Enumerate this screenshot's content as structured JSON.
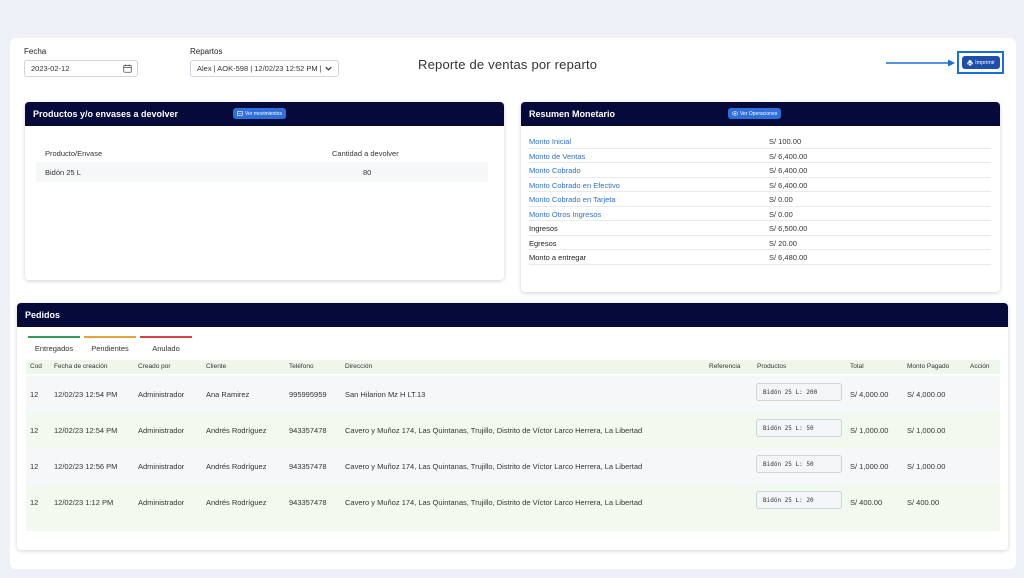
{
  "filters": {
    "fecha_label": "Fecha",
    "fecha_value": "2023-02-12",
    "repartos_label": "Repartos",
    "repartos_value": "Alex | AOK-598 | 12/02/23 12:52 PM |"
  },
  "page_title": "Reporte de ventas por reparto",
  "print_label": "Imprimir",
  "colors": {
    "navy": "#050a3a",
    "accent": "#1f4fa8",
    "link": "#2f6fc4",
    "tab_green": "#3a9a5a",
    "tab_orange": "#e8a23a",
    "tab_red": "#d64545"
  },
  "productos": {
    "title": "Productos y/o envases a devolver",
    "button": "Ver movimientos",
    "headers": [
      "Producto/Envase",
      "Cantidad a devolver"
    ],
    "rows": [
      {
        "producto": "Bidón 25 L",
        "cantidad": "80"
      }
    ]
  },
  "resumen": {
    "title": "Resumen Monetario",
    "button": "Ver Operaciones",
    "rows": [
      {
        "label": "Monto Inicial",
        "value": "S/ 100.00",
        "link": true
      },
      {
        "label": "Monto de Ventas",
        "value": "S/ 6,400.00",
        "link": true
      },
      {
        "label": "Monto Cobrado",
        "value": "S/ 6,400.00",
        "link": true
      },
      {
        "label": "Monto Cobrado en Efectivo",
        "value": "S/ 6,400.00",
        "link": true
      },
      {
        "label": "Monto Cobrado en Tarjeta",
        "value": "S/ 0.00",
        "link": true
      },
      {
        "label": "Monto Otros Ingresos",
        "value": "S/ 0.00",
        "link": true
      },
      {
        "label": "Ingresos",
        "value": "S/ 6,500.00",
        "link": false
      },
      {
        "label": "Egresos",
        "value": "S/ 20.00",
        "link": false
      },
      {
        "label": "Monto a entregar",
        "value": "S/ 6,480.00",
        "link": false
      }
    ]
  },
  "pedidos": {
    "title": "Pedidos",
    "tabs": [
      "Entregados",
      "Pendientes",
      "Anulado"
    ],
    "headers": [
      "Cod",
      "Fecha de creación",
      "Creado por",
      "Cliente",
      "Teléfono",
      "Dirección",
      "Referencia",
      "Productos",
      "Total",
      "Monto Pagado",
      "Acción"
    ],
    "rows": [
      {
        "cod": "12",
        "fecha": "12/02/23 12:54 PM",
        "creado": "Administrador",
        "cliente": "Ana Ramirez",
        "telefono": "995995959",
        "direccion": "San Hilarion Mz H LT.13",
        "referencia": "",
        "productos": "Bidón 25 L: 200",
        "total": "S/ 4,000.00",
        "pagado": "S/ 4,000.00"
      },
      {
        "cod": "12",
        "fecha": "12/02/23 12:54 PM",
        "creado": "Administrador",
        "cliente": "Andrés Rodríguez",
        "telefono": "943357478",
        "direccion": "Cavero y Muñoz 174, Las Quintanas, Trujillo, Distrito de Víctor Larco Herrera, La Libertad",
        "referencia": "",
        "productos": "Bidón 25 L: 50",
        "total": "S/ 1,000.00",
        "pagado": "S/ 1,000.00"
      },
      {
        "cod": "12",
        "fecha": "12/02/23 12:56 PM",
        "creado": "Administrador",
        "cliente": "Andrés Rodríguez",
        "telefono": "943357478",
        "direccion": "Cavero y Muñoz 174, Las Quintanas, Trujillo, Distrito de Víctor Larco Herrera, La Libertad",
        "referencia": "",
        "productos": "Bidón 25 L: 50",
        "total": "S/ 1,000.00",
        "pagado": "S/ 1,000.00"
      },
      {
        "cod": "12",
        "fecha": "12/02/23 1:12 PM",
        "creado": "Administrador",
        "cliente": "Andrés Rodríguez",
        "telefono": "943357478",
        "direccion": "Cavero y Muñoz 174, Las Quintanas, Trujillo, Distrito de Víctor Larco Herrera, La Libertad",
        "referencia": "",
        "productos": "Bidón 25 L: 20",
        "total": "S/ 400.00",
        "pagado": "S/ 400.00"
      }
    ]
  }
}
